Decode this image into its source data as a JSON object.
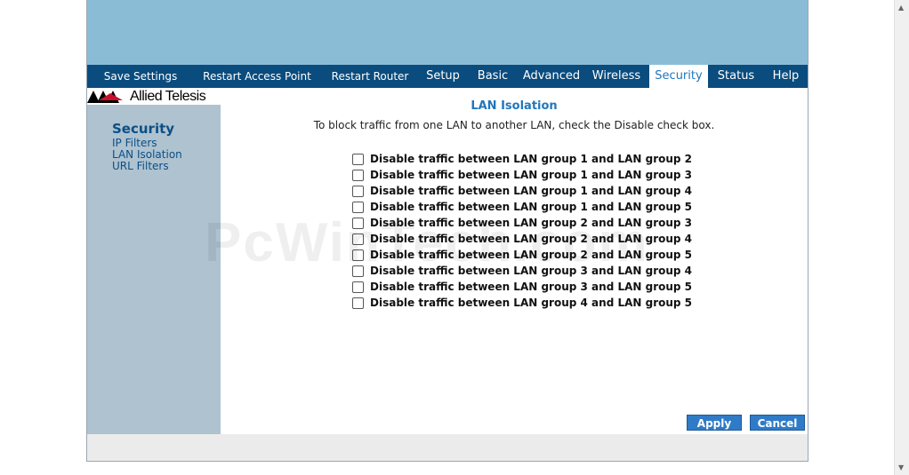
{
  "nav": {
    "items": [
      {
        "label": "Save Settings"
      },
      {
        "label": "Restart Access Point"
      },
      {
        "label": "Restart Router"
      },
      {
        "label": "Setup"
      },
      {
        "label": "Basic"
      },
      {
        "label": "Advanced"
      },
      {
        "label": "Wireless"
      },
      {
        "label": "Security",
        "active": true
      },
      {
        "label": "Status"
      },
      {
        "label": "Help"
      }
    ]
  },
  "logo": {
    "text": "Allied Telesis"
  },
  "sidebar": {
    "title": "Security",
    "links": [
      {
        "label": "IP Filters"
      },
      {
        "label": "LAN Isolation"
      },
      {
        "label": "URL Filters"
      }
    ]
  },
  "main": {
    "heading": "LAN Isolation",
    "instructions": "To block traffic from one LAN to another LAN, check the Disable check box.",
    "options": [
      {
        "label": "Disable traffic between LAN group 1 and LAN group 2",
        "checked": false
      },
      {
        "label": "Disable traffic between LAN group 1 and LAN group 3",
        "checked": false
      },
      {
        "label": "Disable traffic between LAN group 1 and LAN group 4",
        "checked": false
      },
      {
        "label": "Disable traffic between LAN group 1 and LAN group 5",
        "checked": false
      },
      {
        "label": "Disable traffic between LAN group 2 and LAN group 3",
        "checked": false
      },
      {
        "label": "Disable traffic between LAN group 2 and LAN group 4",
        "checked": false
      },
      {
        "label": "Disable traffic between LAN group 2 and LAN group 5",
        "checked": false
      },
      {
        "label": "Disable traffic between LAN group 3 and LAN group 4",
        "checked": false
      },
      {
        "label": "Disable traffic between LAN group 3 and LAN group 5",
        "checked": false
      },
      {
        "label": "Disable traffic between LAN group 4 and LAN group 5",
        "checked": false
      }
    ],
    "apply_label": "Apply",
    "cancel_label": "Cancel"
  },
  "watermark": "PcWinTech.com",
  "colors": {
    "nav_bg": "#0a4c7e",
    "banner": "#8bbcd6",
    "sidebar": "#aec2d0",
    "accent": "#2276bc",
    "button": "#2f7bc8"
  }
}
